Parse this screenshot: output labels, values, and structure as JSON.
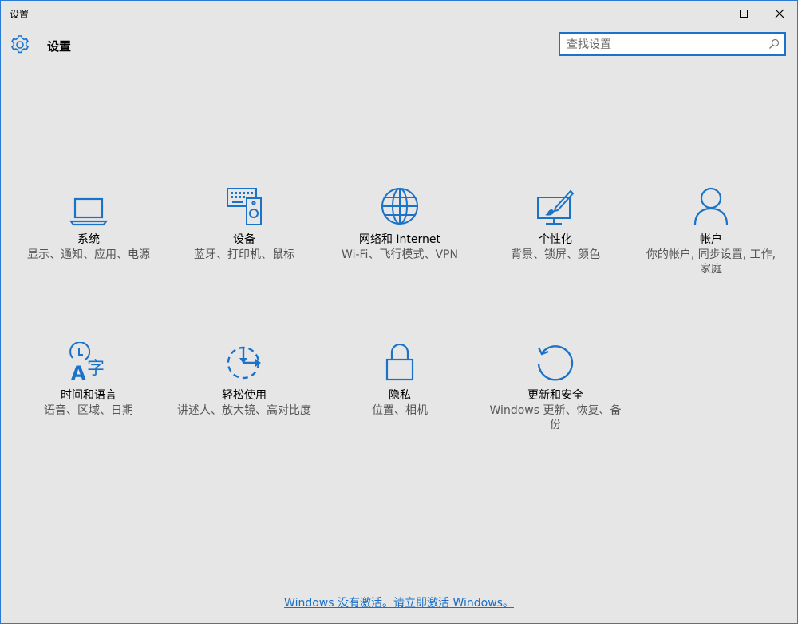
{
  "window": {
    "title": "设置"
  },
  "header": {
    "title": "设置"
  },
  "search": {
    "placeholder": "查找设置"
  },
  "accent_color": "#1a73c9",
  "tiles": [
    {
      "name": "系统",
      "desc": "显示、通知、应用、电源",
      "icon": "laptop-icon"
    },
    {
      "name": "设备",
      "desc": "蓝牙、打印机、鼠标",
      "icon": "devices-icon"
    },
    {
      "name": "网络和 Internet",
      "desc": "Wi-Fi、飞行模式、VPN",
      "icon": "globe-icon"
    },
    {
      "name": "个性化",
      "desc": "背景、锁屏、颜色",
      "icon": "personalization-icon"
    },
    {
      "name": "帐户",
      "desc": "你的帐户, 同步设置, 工作, 家庭",
      "icon": "person-icon"
    },
    {
      "name": "时间和语言",
      "desc": "语音、区域、日期",
      "icon": "time-language-icon"
    },
    {
      "name": "轻松使用",
      "desc": "讲述人、放大镜、高对比度",
      "icon": "ease-of-access-icon"
    },
    {
      "name": "隐私",
      "desc": "位置、相机",
      "icon": "lock-icon"
    },
    {
      "name": "更新和安全",
      "desc": "Windows 更新、恢复、备份",
      "icon": "update-icon"
    }
  ],
  "activation": {
    "link": "Windows 没有激活。请立即激活 Windows。"
  }
}
